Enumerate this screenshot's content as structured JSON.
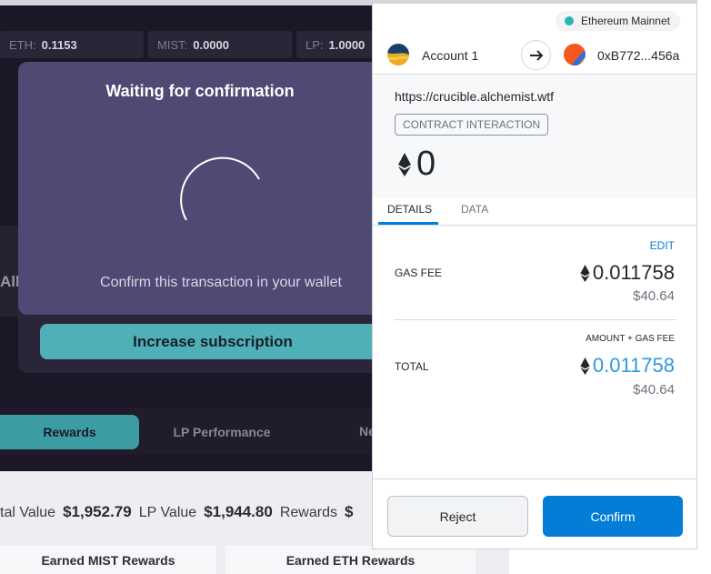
{
  "dapp": {
    "balances": [
      {
        "label": "ETH:",
        "value": "0.1153"
      },
      {
        "label": "MIST:",
        "value": "0.0000"
      },
      {
        "label": "LP:",
        "value": "1.0000"
      }
    ],
    "partial_left_text": "All",
    "modal": {
      "title": "Waiting for confirmation",
      "message": "Confirm this transaction in your wallet"
    },
    "increase_button": "Increase subscription",
    "tabs": [
      "Rewards",
      "LP Performance",
      "Ne"
    ],
    "stats": {
      "total_value_label": "tal Value",
      "total_value": "$1,952.79",
      "lp_value_label": "LP Value",
      "lp_value": "$1,944.80",
      "rewards_label": "Rewards",
      "rewards_partial": "$"
    },
    "earned": [
      "Earned MIST Rewards",
      "Earned ETH Rewards"
    ]
  },
  "metamask": {
    "network": "Ethereum Mainnet",
    "network_color": "#29b6af",
    "from_account": "Account 1",
    "to_address": "0xB772...456a",
    "origin": "https://crucible.alchemist.wtf",
    "action": "CONTRACT INTERACTION",
    "amount": "0",
    "tabs": {
      "details": "DETAILS",
      "data": "DATA"
    },
    "edit": "EDIT",
    "gas_fee": {
      "label": "GAS FEE",
      "eth": "0.011758",
      "usd": "$40.64"
    },
    "total": {
      "sublabel": "AMOUNT + GAS FEE",
      "label": "TOTAL",
      "eth": "0.011758",
      "usd": "$40.64"
    },
    "reject": "Reject",
    "confirm": "Confirm",
    "accent": "#037dd6"
  }
}
